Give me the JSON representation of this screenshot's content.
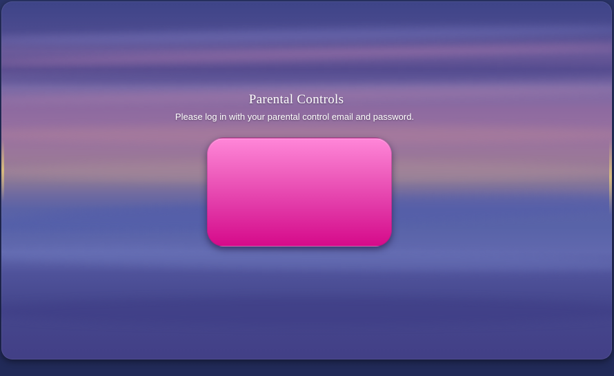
{
  "dialog": {
    "title": "Parental Controls",
    "subtitle": "Please log in with your parental control email and password."
  },
  "colors": {
    "login_box_top": "#ff86d8",
    "login_box_bottom": "#d60a8a",
    "background_base": "#232c5c"
  }
}
